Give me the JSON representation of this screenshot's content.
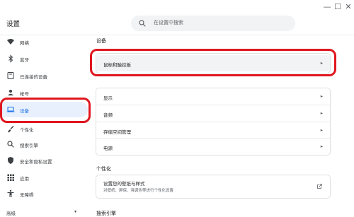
{
  "window": {
    "minimize": "—",
    "maximize": "☐",
    "close": "✕"
  },
  "header": {
    "title": "设置",
    "search_placeholder": "在设置中搜索"
  },
  "sidebar": {
    "items": [
      {
        "label": "网络",
        "icon": "wifi-icon"
      },
      {
        "label": "蓝牙",
        "icon": "bluetooth-icon"
      },
      {
        "label": "已连接的设备",
        "icon": "connected-devices-icon"
      },
      {
        "label": "帐号",
        "icon": "account-icon"
      },
      {
        "label": "设备",
        "icon": "laptop-icon",
        "selected": true
      },
      {
        "label": "个性化",
        "icon": "brush-icon"
      },
      {
        "label": "搜索引擎",
        "icon": "search-icon"
      },
      {
        "label": "安全和隐私设置",
        "icon": "shield-icon"
      },
      {
        "label": "应用",
        "icon": "apps-grid-icon"
      },
      {
        "label": "无障碍",
        "icon": "accessibility-icon"
      }
    ],
    "advanced": "高级",
    "advanced_caret": "▾"
  },
  "main": {
    "device_heading": "设备",
    "device_rows": [
      {
        "label": "鼠标和触控板",
        "arrow": "▸"
      },
      {
        "label": "显示",
        "arrow": "▸"
      },
      {
        "label": "音频",
        "arrow": "▸"
      },
      {
        "label": "存储空间管理",
        "arrow": "▸"
      },
      {
        "label": "电源",
        "arrow": "▸"
      }
    ],
    "personalization_heading": "个性化",
    "personalization": {
      "title": "设置您的壁纸与样式",
      "subtitle": "对壁纸、屏保、强调色等进行个性化设置",
      "icon": "open-external-icon"
    },
    "search_heading": "搜索引擎"
  },
  "colors": {
    "accent": "#1a73e8",
    "selected_bg": "#e8f0fe",
    "highlight": "#e0161e"
  }
}
